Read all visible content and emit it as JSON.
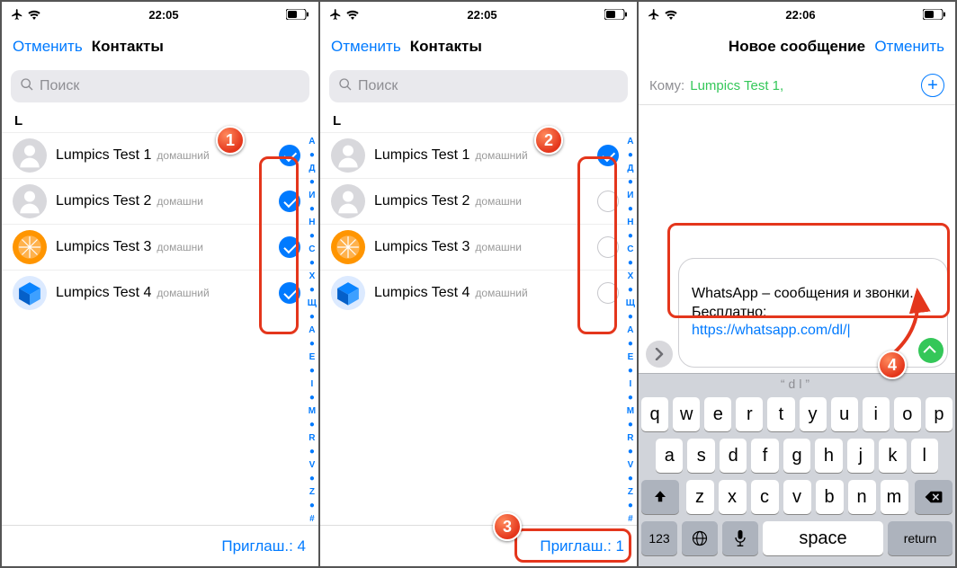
{
  "screens": [
    {
      "status_time": "22:05",
      "cancel": "Отменить",
      "title": "Контакты",
      "search_ph": "Поиск",
      "section": "L",
      "footer": "Приглаш.: 4"
    },
    {
      "status_time": "22:05",
      "cancel": "Отменить",
      "title": "Контакты",
      "search_ph": "Поиск",
      "section": "L",
      "footer": "Приглаш.: 1"
    },
    {
      "status_time": "22:06",
      "title": "Новое сообщение",
      "cancel": "Отменить",
      "to_label": "Кому:",
      "to_recipient": "Lumpics Test 1,",
      "msg_text": "WhatsApp – сообщения и звонки. Бесплатно: ",
      "msg_link": "https://whatsapp.com/dl/",
      "hint": "“dl”",
      "key_space": "space",
      "key_return": "return",
      "key_123": "123"
    }
  ],
  "contacts": [
    {
      "name": "Lumpics Test 1",
      "label": "домашний"
    },
    {
      "name": "Lumpics Test 2",
      "label": "домашни"
    },
    {
      "name": "Lumpics Test 3",
      "label": "домашни"
    },
    {
      "name": "Lumpics Test 4",
      "label": "домашний"
    }
  ],
  "index_letters": [
    "А",
    "●",
    "Д",
    "●",
    "И",
    "●",
    "Н",
    "●",
    "С",
    "●",
    "Х",
    "●",
    "Щ",
    "●",
    "А",
    "●",
    "Е",
    "●",
    "I",
    "●",
    "М",
    "●",
    "R",
    "●",
    "V",
    "●",
    "Z",
    "●",
    "#"
  ],
  "kb_row1": [
    "q",
    "w",
    "e",
    "r",
    "t",
    "y",
    "u",
    "i",
    "o",
    "p"
  ],
  "kb_row2": [
    "a",
    "s",
    "d",
    "f",
    "g",
    "h",
    "j",
    "k",
    "l"
  ],
  "kb_row3": [
    "z",
    "x",
    "c",
    "v",
    "b",
    "n",
    "m"
  ],
  "callouts": {
    "c1": "1",
    "c2": "2",
    "c3": "3",
    "c4": "4"
  }
}
